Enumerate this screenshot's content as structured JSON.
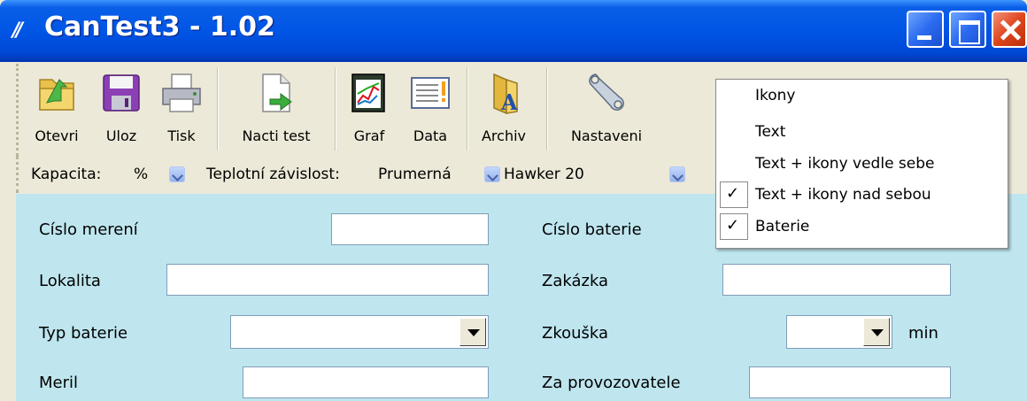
{
  "window": {
    "title": "CanTest3 - 1.02",
    "logo_glyph": "//"
  },
  "toolbar": {
    "buttons": [
      {
        "label": "Otevri",
        "icon": "open-folder-icon"
      },
      {
        "label": "Uloz",
        "icon": "floppy-disk-icon"
      },
      {
        "label": "Tisk",
        "icon": "printer-icon"
      },
      {
        "label": "Nacti test",
        "icon": "load-document-icon"
      },
      {
        "label": "Graf",
        "icon": "graph-icon"
      },
      {
        "label": "Data",
        "icon": "data-icon"
      },
      {
        "label": "Archiv",
        "icon": "archive-folder-icon"
      },
      {
        "label": "Nastaveni",
        "icon": "wrench-icon"
      }
    ]
  },
  "filters": {
    "kapacita_label": "Kapacita:",
    "kapacita_value": "%",
    "teplota_label": "Teplotní závislost:",
    "teplota_value": "Prumerná",
    "battery_value": "Hawker 20"
  },
  "form": {
    "cislo_mereni": "Císlo merení",
    "lokalita": "Lokalita",
    "typ_baterie": "Typ baterie",
    "meril": "Meril",
    "cislo_baterie": "Císlo baterie",
    "zakazka": "Zakázka",
    "zkouska": "Zkouška",
    "min": "min",
    "za_provozovatele": "Za provozovatele"
  },
  "context_menu": {
    "items": [
      {
        "label": "Ikony",
        "checked": false
      },
      {
        "label": "Text",
        "checked": false
      },
      {
        "label": "Text + ikony vedle sebe",
        "checked": false
      },
      {
        "label": "Text + ikony nad sebou",
        "checked": true
      },
      {
        "label": "Baterie",
        "checked": true
      }
    ],
    "check_glyph": "✓"
  }
}
